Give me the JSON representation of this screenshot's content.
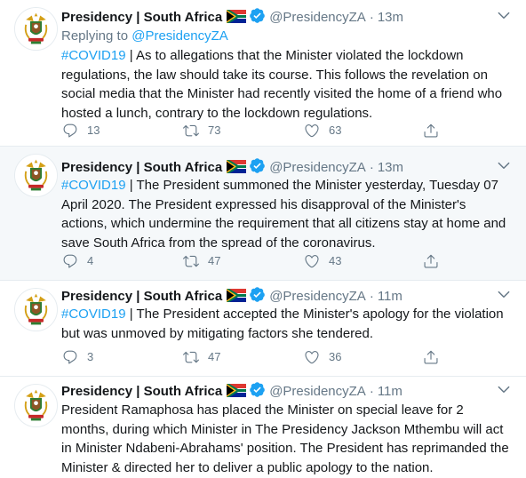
{
  "account": {
    "name": "Presidency | South Africa",
    "handle": "@PresidencyZA",
    "separator": "·"
  },
  "colors": {
    "link": "#1da1f2",
    "muted": "#657786",
    "text": "#14171a",
    "highlight_bg": "#f5f8fa",
    "border": "#e6ecf0"
  },
  "tweets": [
    {
      "time": "13m",
      "replying_prefix": "Replying to",
      "replying_handle": "@PresidencyZA",
      "hashtag": "#COVID19",
      "text": " | As to allegations that the Minister violated the lockdown regulations, the law should take its course. This follows the revelation on social media that the Minister had recently visited the home of a friend who hosted a lunch, contrary to the lockdown regulations.",
      "replies": "13",
      "retweets": "73",
      "likes": "63"
    },
    {
      "time": "13m",
      "hashtag": "#COVID19",
      "text": " | The President summoned the Minister yesterday, Tuesday 07 April 2020. The President expressed his disapproval of the Minister's actions, which undermine the requirement that all citizens stay at home and save South Africa from the spread of the coronavirus.",
      "replies": "4",
      "retweets": "47",
      "likes": "43"
    },
    {
      "time": "11m",
      "hashtag": "#COVID19",
      "text": " | The President accepted the Minister's apology for the violation but was unmoved by mitigating factors she tendered.",
      "replies": "3",
      "retweets": "47",
      "likes": "36"
    },
    {
      "time": "11m",
      "text": "President Ramaphosa has placed the Minister on special leave for 2 months, during which Minister in The Presidency Jackson Mthembu will act in Minister Ndabeni-Abrahams' position. The President has reprimanded the Minister & directed her to deliver a public apology to the nation."
    }
  ],
  "icons": {
    "verified": "verified-badge-icon",
    "flag": "south-africa-flag-icon",
    "caret": "chevron-down-icon",
    "reply": "reply-icon",
    "retweet": "retweet-icon",
    "like": "heart-icon",
    "share": "share-icon"
  }
}
